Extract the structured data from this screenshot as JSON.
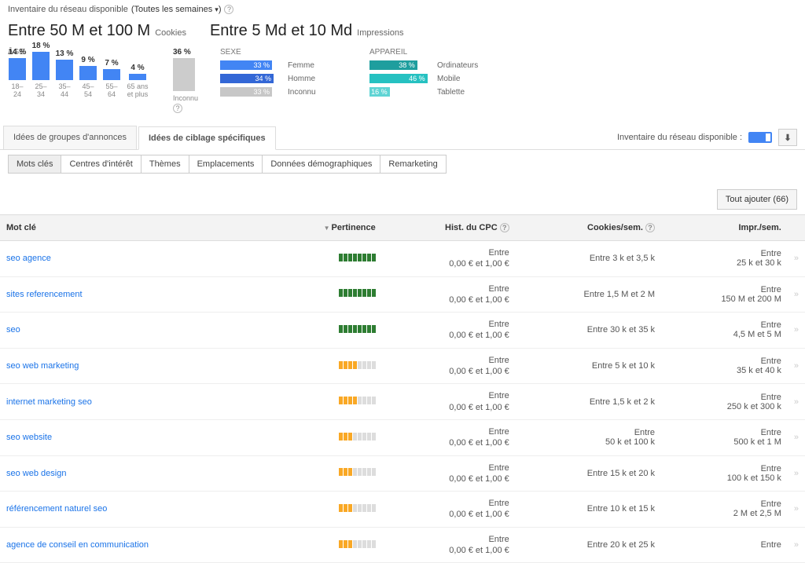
{
  "header": {
    "inventory_label": "Inventaire du réseau disponible",
    "frequency_label": "(Toutes les semaines",
    "frequency_chev": "▾",
    "frequency_close": ")"
  },
  "metrics": {
    "cookies_value": "Entre 50 M et 100 M",
    "cookies_unit": "Cookies",
    "impressions_value": "Entre 5 Md et 10 Md",
    "impressions_unit": "Impressions"
  },
  "chart_data": {
    "age": {
      "label": "ÂGE",
      "type": "bar",
      "categories": [
        "18–24",
        "25–34",
        "35–44",
        "45–54",
        "55–64",
        "65 ans et plus"
      ],
      "values_pct": [
        14,
        18,
        13,
        9,
        7,
        4
      ],
      "ylim": [
        0,
        20
      ]
    },
    "unknown": {
      "pct": 36,
      "label": "Inconnu"
    },
    "sex": {
      "label": "SEXE",
      "type": "bar_horizontal",
      "items": [
        {
          "name": "Femme",
          "pct": 33,
          "color": "#4285f4"
        },
        {
          "name": "Homme",
          "pct": 34,
          "color": "#3367d6"
        },
        {
          "name": "Inconnu",
          "pct": 33,
          "color": "#c7c7c7"
        }
      ]
    },
    "device": {
      "label": "APPAREIL",
      "type": "bar_horizontal",
      "items": [
        {
          "name": "Ordinateurs",
          "pct": 38,
          "color": "#1e9e9e"
        },
        {
          "name": "Mobile",
          "pct": 46,
          "color": "#26c1c1"
        },
        {
          "name": "Tablette",
          "pct": 16,
          "color": "#5fd4d4"
        }
      ]
    }
  },
  "tabs_main": {
    "items": [
      "Idées de groupes d'annonces",
      "Idées de ciblage spécifiques"
    ],
    "active": 1,
    "inventory_toggle_label": "Inventaire du réseau disponible :"
  },
  "sub_tabs": {
    "items": [
      "Mots clés",
      "Centres d'intérêt",
      "Thèmes",
      "Emplacements",
      "Données démographiques",
      "Remarketing"
    ],
    "active": 0
  },
  "add_all": {
    "label": "Tout ajouter (66)"
  },
  "table": {
    "headers": {
      "keyword": "Mot clé",
      "relevance": "Pertinence",
      "cpc": "Hist. du CPC",
      "cookies": "Cookies/sem.",
      "impr": "Impr./sem."
    },
    "cpc_prefix": "Entre",
    "cpc_range": "0,00 € et 1,00 €",
    "entre": "Entre",
    "rows": [
      {
        "kw": "seo agence",
        "rel": 8,
        "color": "g",
        "cookies": "Entre 3 k et 3,5 k",
        "impr": "25 k et 30 k"
      },
      {
        "kw": "sites referencement",
        "rel": 8,
        "color": "g",
        "cookies": "Entre 1,5 M et 2 M",
        "impr": "150 M et 200 M"
      },
      {
        "kw": "seo",
        "rel": 8,
        "color": "g",
        "cookies": "Entre 30 k et 35 k",
        "impr": "4,5 M et 5 M"
      },
      {
        "kw": "seo web marketing",
        "rel": 4,
        "color": "y",
        "cookies": "Entre 5 k et 10 k",
        "impr": "35 k et 40 k"
      },
      {
        "kw": "internet marketing seo",
        "rel": 4,
        "color": "y",
        "cookies": "Entre 1,5 k et 2 k",
        "impr": "250 k et 300 k"
      },
      {
        "kw": "seo website",
        "rel": 3,
        "color": "y",
        "cookies": "50 k et 100 k",
        "impr": "500 k et 1 M"
      },
      {
        "kw": "seo web design",
        "rel": 3,
        "color": "y",
        "cookies": "Entre 15 k et 20 k",
        "impr": "100 k et 150 k"
      },
      {
        "kw": "référencement naturel seo",
        "rel": 3,
        "color": "y",
        "cookies": "Entre 10 k et 15 k",
        "impr": "2 M et 2,5 M"
      },
      {
        "kw": "agence de conseil en communication",
        "rel": 3,
        "color": "y",
        "cookies": "Entre 20 k et 25 k",
        "impr": ""
      }
    ]
  }
}
